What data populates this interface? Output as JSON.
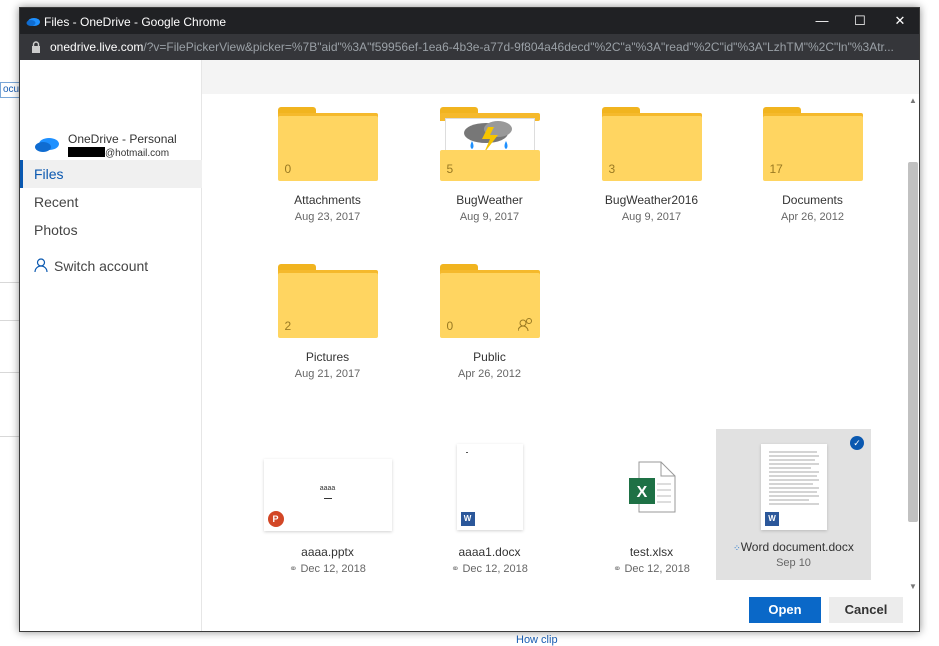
{
  "background": {
    "tab_text": "ocu",
    "link_text": "How clip"
  },
  "window": {
    "title": "Files - OneDrive - Google Chrome",
    "url_host": "onedrive.live.com",
    "url_rest": "/?v=FilePickerView&picker=%7B\"aid\"%3A\"f59956ef-1ea6-4b3e-a77d-9f804a46decd\"%2C\"a\"%3A\"read\"%2C\"id\"%3A\"LzhTM\"%2C\"ln\"%3Atr..."
  },
  "account": {
    "name": "OneDrive - Personal",
    "email_suffix": "@hotmail.com"
  },
  "nav": [
    {
      "label": "Files"
    },
    {
      "label": "Recent"
    },
    {
      "label": "Photos"
    }
  ],
  "switch_account": "Switch account",
  "folders": [
    {
      "name": "Attachments",
      "date": "Aug 23, 2017",
      "count": "0"
    },
    {
      "name": "BugWeather",
      "date": "Aug 9, 2017",
      "count": "5"
    },
    {
      "name": "BugWeather2016",
      "date": "Aug 9, 2017",
      "count": "3"
    },
    {
      "name": "Documents",
      "date": "Apr 26, 2012",
      "count": "17"
    },
    {
      "name": "Pictures",
      "date": "Aug 21, 2017",
      "count": "2"
    },
    {
      "name": "Public",
      "date": "Apr 26, 2012",
      "count": "0"
    }
  ],
  "files": [
    {
      "name": "aaaa.pptx",
      "date": "Dec 12, 2018",
      "preview": "aaaa",
      "app": "P"
    },
    {
      "name": "aaaa1.docx",
      "date": "Dec 12, 2018",
      "app": "W"
    },
    {
      "name": "test.xlsx",
      "date": "Dec 12, 2018",
      "app": "X"
    },
    {
      "name": "Word document.docx",
      "date": "Sep 10",
      "app": "W"
    }
  ],
  "buttons": {
    "open": "Open",
    "cancel": "Cancel"
  },
  "colors": {
    "accent": "#0a68c8",
    "folder": "#ffd561",
    "folder_tab": "#f1b41f"
  }
}
